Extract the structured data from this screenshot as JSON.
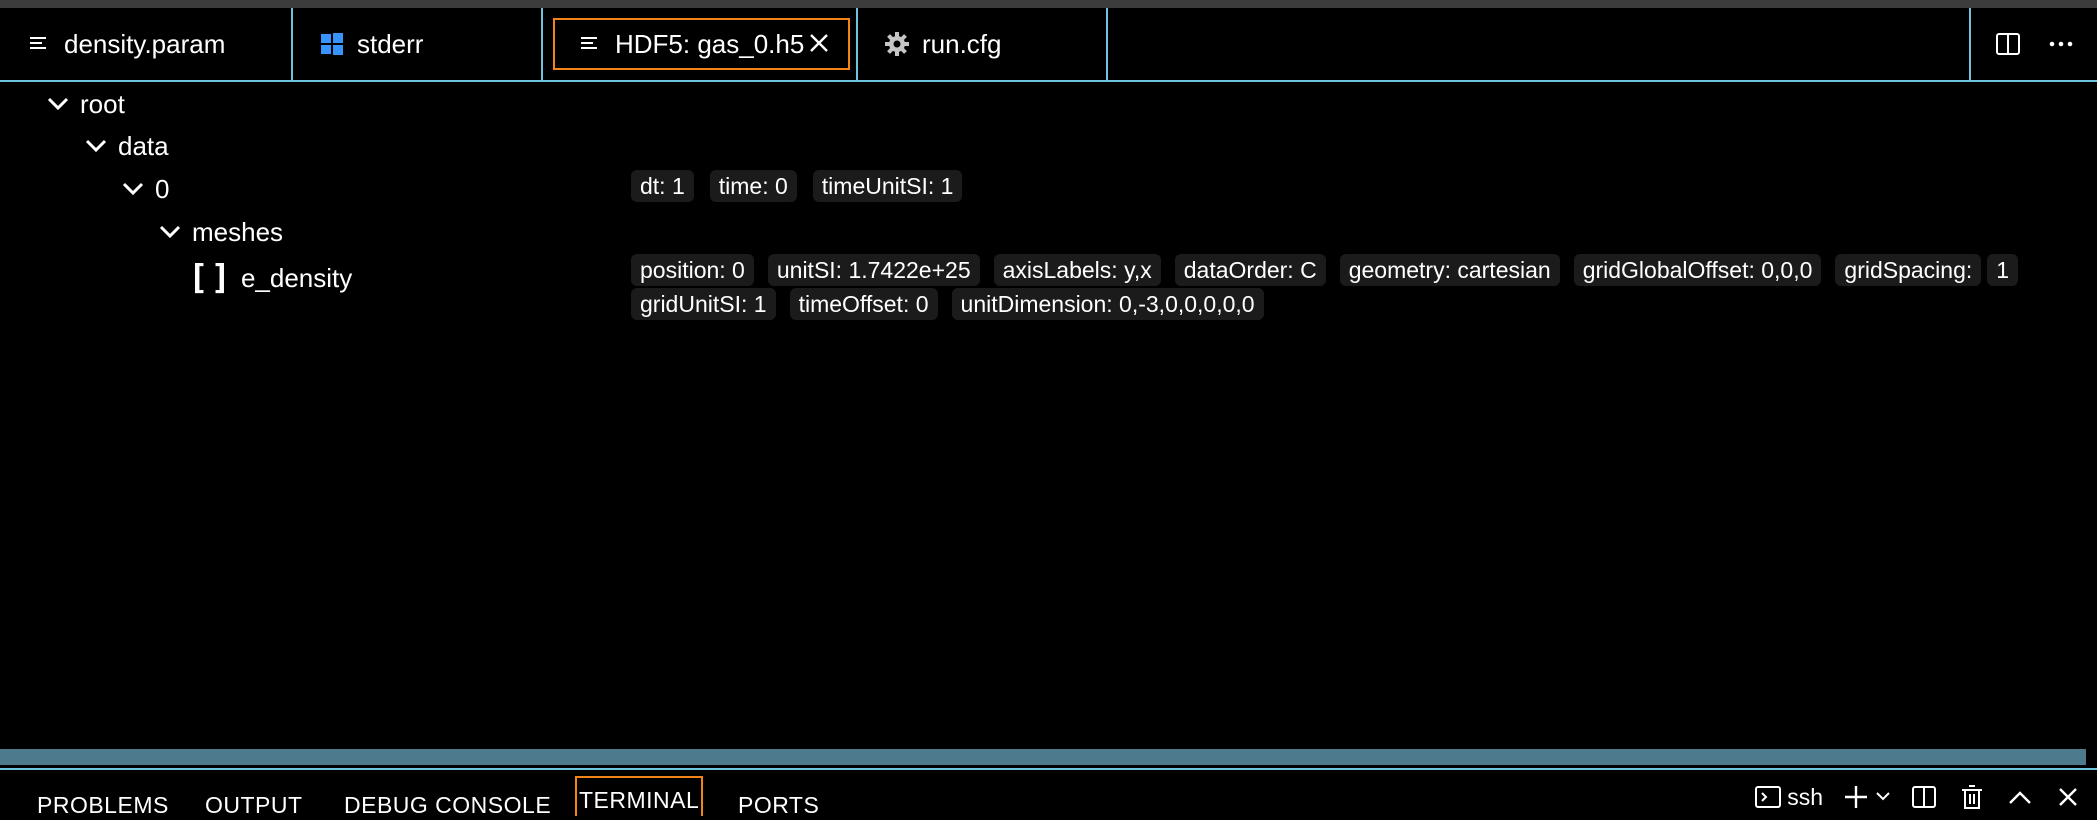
{
  "tabs": [
    {
      "label": "density.param",
      "icon": "lines-icon"
    },
    {
      "label": "stderr",
      "icon": "windows-icon"
    },
    {
      "label": "HDF5: gas_0.h5",
      "icon": "lines-icon",
      "active": true
    },
    {
      "label": "run.cfg",
      "icon": "gear-icon"
    }
  ],
  "tree": {
    "root": "root",
    "data": "data",
    "zero": "0",
    "meshes": "meshes",
    "e_density": "e_density"
  },
  "attrs_0": [
    "dt: 1",
    "time: 0",
    "timeUnitSI: 1"
  ],
  "attrs_e_density": [
    "position: 0",
    "unitSI: 1.7422e+25",
    "axisLabels: y,x",
    "dataOrder: C",
    "geometry: cartesian",
    "gridGlobalOffset: 0,0,0",
    "gridSpacing:",
    "1",
    "gridUnitSI: 1",
    "timeOffset: 0",
    "unitDimension: 0,-3,0,0,0,0,0"
  ],
  "panel": {
    "tabs": [
      "PROBLEMS",
      "OUTPUT",
      "DEBUG CONSOLE",
      "TERMINAL",
      "PORTS"
    ],
    "active": "TERMINAL",
    "terminal_name": "ssh"
  },
  "colors": {
    "accent_border": "#6fc3df",
    "focus": "#f38518",
    "windows_blue": "#3794ff"
  }
}
